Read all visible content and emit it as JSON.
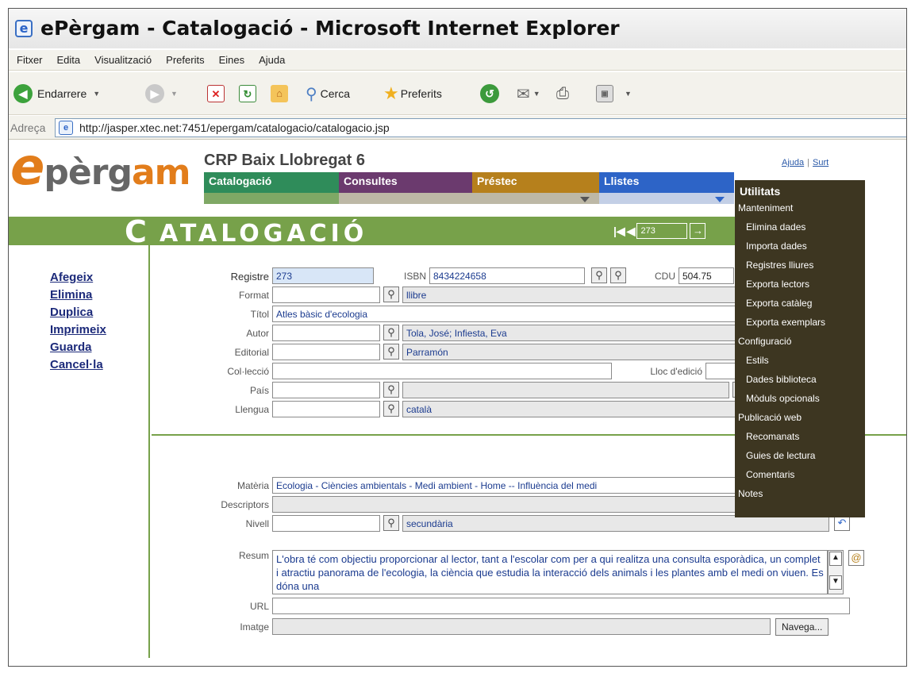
{
  "window": {
    "title": "ePèrgam - Catalogació - Microsoft Internet Explorer"
  },
  "menubar": [
    "Fitxer",
    "Edita",
    "Visualització",
    "Preferits",
    "Eines",
    "Ajuda"
  ],
  "toolbar": {
    "back": "Endarrere",
    "search": "Cerca",
    "favorites": "Preferits"
  },
  "address": {
    "label": "Adreça",
    "url": "http://jasper.xtec.net:7451/epergam/catalogacio/catalogacio.jsp"
  },
  "app": {
    "logo": {
      "e": "e",
      "mid": "pèrg",
      "end": "am"
    },
    "center": "CRP Baix Llobregat 6",
    "help": "Ajuda",
    "sep": "|",
    "exit": "Surt",
    "tabs": [
      "Catalogació",
      "Consultes",
      "Préstec",
      "Llistes",
      "Utilitats"
    ],
    "heading_initial": "C",
    "heading_rest": "ATALOGACIÓ",
    "record_number": "273",
    "record_go": "→"
  },
  "actions": [
    "Afegeix",
    "Elimina",
    "Duplica",
    "Imprimeix",
    "Guarda",
    "Cancel·la"
  ],
  "form": {
    "registre_label": "Registre",
    "registre": "273",
    "isbn_label": "ISBN",
    "isbn": "8434224658",
    "cdu_label": "CDU",
    "cdu": "504.75",
    "format_label": "Format",
    "format": "llibre",
    "titol_label": "Títol",
    "titol": "Atles bàsic d'ecologia",
    "autor_label": "Autor",
    "autor": "Tola, José; Infiesta, Eva",
    "editorial_label": "Editorial",
    "editorial": "Parramón",
    "colleccio_label": "Col·lecció",
    "lloc_label": "Lloc d'edició",
    "pais_label": "País",
    "llengua_label": "Llengua",
    "llengua": "català",
    "materia_label": "Matèria",
    "materia": "Ecologia - Ciències ambientals - Medi ambient - Home -- Influència del medi",
    "descriptors_label": "Descriptors",
    "nivell_label": "Nivell",
    "nivell": "secundària",
    "resum_label": "Resum",
    "resum": "L'obra té com objectiu proporcionar al lector, tant a l'escolar com per a qui realitza una consulta esporàdica, un complet i atractiu panorama de l'ecologia, la ciència que estudia la interacció dels animals i les plantes amb el medi on viuen. Es dóna una",
    "url_label": "URL",
    "imatge_label": "Imatge",
    "browse": "Navega..."
  },
  "utilitats_menu": {
    "title": "Utilitats",
    "items": [
      {
        "label": "Manteniment",
        "level": 0
      },
      {
        "label": "Elimina dades",
        "level": 1
      },
      {
        "label": "Importa dades",
        "level": 1
      },
      {
        "label": "Registres lliures",
        "level": 1
      },
      {
        "label": "Exporta lectors",
        "level": 1
      },
      {
        "label": "Exporta catàleg",
        "level": 1
      },
      {
        "label": "Exporta exemplars",
        "level": 1
      },
      {
        "label": "Configuració",
        "level": 0
      },
      {
        "label": "Estils",
        "level": 1
      },
      {
        "label": "Dades biblioteca",
        "level": 1
      },
      {
        "label": "Mòduls opcionals",
        "level": 1
      },
      {
        "label": "Publicació web",
        "level": 0
      },
      {
        "label": "Recomanats",
        "level": 1
      },
      {
        "label": "Guies de lectura",
        "level": 1
      },
      {
        "label": "Comentaris",
        "level": 1
      },
      {
        "label": "Notes",
        "level": 0
      }
    ]
  },
  "colors": {
    "green": "#77a14a",
    "teal": "#2f8c5a",
    "purple": "#6b3a6e",
    "gold": "#b6801c",
    "blue": "#2d64c7",
    "menu_bg": "#3d3621",
    "orange": "#e27d1b"
  }
}
